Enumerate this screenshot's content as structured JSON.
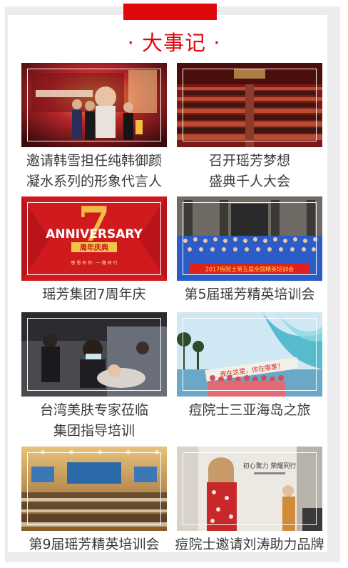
{
  "page": {
    "title": "· 大事记 ·",
    "accent_color": "#e0070d"
  },
  "events": [
    {
      "lines": [
        "邀请韩雪担任纯韩御颜",
        "凝水系列的形象代言人"
      ],
      "image": "spokesperson-award-stage-photo"
    },
    {
      "lines": [
        "召开瑶芳梦想",
        "盛典千人大会"
      ],
      "image": "thousand-person-conference-hall-photo"
    },
    {
      "lines": [
        "瑶芳集团7周年庆"
      ],
      "image": "seventh-anniversary-banner",
      "banner": {
        "line1": "ANNIVERSARY",
        "line2": "周年庆典",
        "line3": "感 恩 有 你 · 一 路 同 行"
      }
    },
    {
      "lines": [
        "第5届瑶芳精英培训会"
      ],
      "image": "training-group-photo",
      "banner": {
        "line1": "2017痘院士第五届全国精英培训会"
      }
    },
    {
      "lines": [
        "台湾美肤专家莅临",
        "集团指导培训"
      ],
      "image": "skincare-training-session-photo"
    },
    {
      "lines": [
        "痘院士三亚海岛之旅"
      ],
      "image": "sanya-island-trip-group-photo",
      "banner": {
        "line1": "我在这里，你在哪里？"
      }
    },
    {
      "lines": [
        "第9届瑶芳精英培训会"
      ],
      "image": "ninth-training-meeting-hall-photo"
    },
    {
      "lines": [
        "痘院士邀请刘涛助力品牌"
      ],
      "image": "brand-ambassador-event-photo",
      "banner": {
        "line1": "初心聚力 荣耀同行"
      }
    }
  ]
}
